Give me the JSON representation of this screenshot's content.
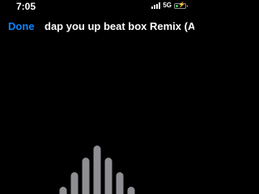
{
  "status_bar": {
    "time": "7:05",
    "network": "5G",
    "signal_icon": "cellular-signal-icon",
    "battery_icon": "battery-charging-icon",
    "battery_level": 0.3
  },
  "nav": {
    "done_label": "Done",
    "title": "dap you up beat box Remix (A-..."
  },
  "waveform": {
    "icon": "audio-waveform",
    "color": "#8e8e93",
    "levels": [
      0.15,
      0.45,
      0.75,
      1.0,
      0.75,
      0.45,
      0.15
    ]
  }
}
